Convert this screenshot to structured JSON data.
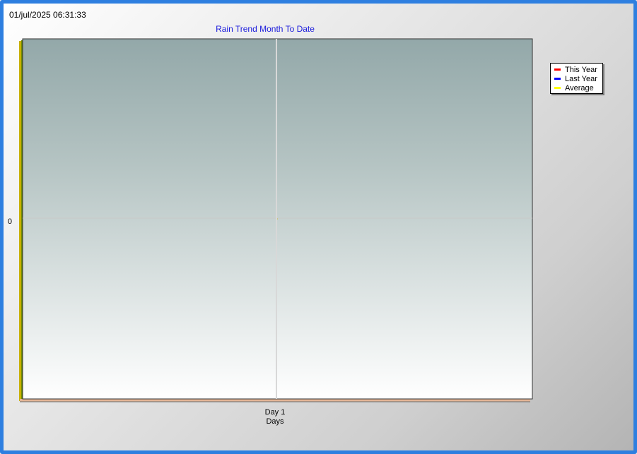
{
  "timestamp": "01/jul/2025 06:31:33",
  "colors": {
    "window_border": "#2e7fe0",
    "title": "#1a1adc",
    "this_year": "#ff0000",
    "last_year": "#0000ff",
    "average": "#ffff00"
  },
  "chart_data": {
    "type": "line",
    "title": "Rain Trend Month To Date",
    "xlabel": "Days",
    "ylabel": "",
    "categories": [
      "Day 1"
    ],
    "y_ticks": [
      "0"
    ],
    "ylim": [
      -1,
      1
    ],
    "grid": true,
    "legend_position": "right",
    "series": [
      {
        "name": "This Year",
        "color": "#ff0000",
        "values": [
          0
        ]
      },
      {
        "name": "Last Year",
        "color": "#0000ff",
        "values": [
          0
        ]
      },
      {
        "name": "Average",
        "color": "#ffff00",
        "values": [
          0
        ]
      }
    ]
  }
}
